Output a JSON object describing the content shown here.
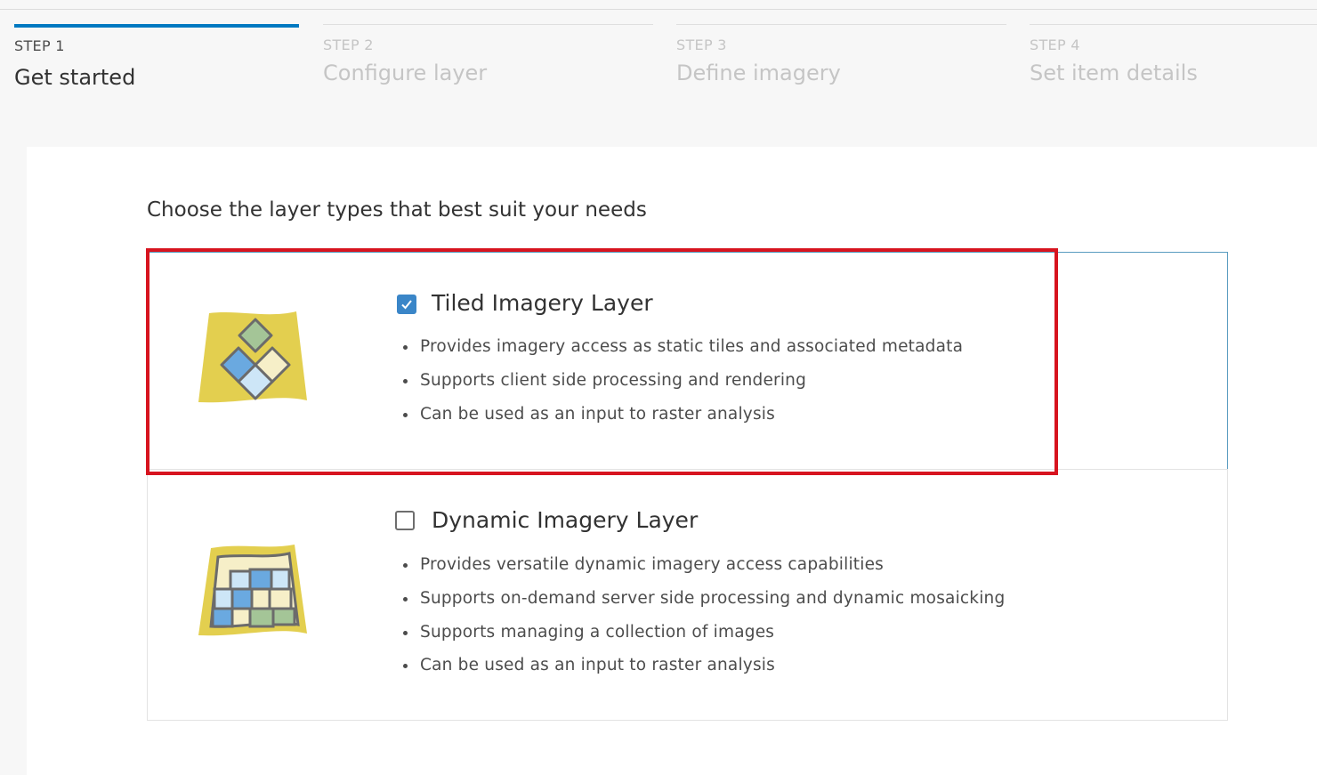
{
  "steps": [
    {
      "number": "STEP 1",
      "title": "Get started",
      "active": true
    },
    {
      "number": "STEP 2",
      "title": "Configure layer",
      "active": false
    },
    {
      "number": "STEP 3",
      "title": "Define imagery",
      "active": false
    },
    {
      "number": "STEP 4",
      "title": "Set item details",
      "active": false
    }
  ],
  "heading": "Choose the layer types that best suit your needs",
  "options": [
    {
      "title": "Tiled Imagery Layer",
      "checked": true,
      "icon": "tiled-imagery-icon",
      "bullets": [
        "Provides imagery access as static tiles and associated metadata",
        "Supports client side processing and rendering",
        "Can be used as an input to raster analysis"
      ]
    },
    {
      "title": "Dynamic Imagery Layer",
      "checked": false,
      "icon": "dynamic-imagery-icon",
      "bullets": [
        "Provides versatile dynamic imagery access capabilities",
        "Supports on-demand server side processing and dynamic mosaicking",
        "Supports managing a collection of images",
        "Can be used as an input to raster analysis"
      ]
    }
  ],
  "colors": {
    "accent": "#0079c1",
    "checkbox": "#3a86c8",
    "highlight": "#d7141f",
    "map_yellow": "#e3cf4f"
  }
}
